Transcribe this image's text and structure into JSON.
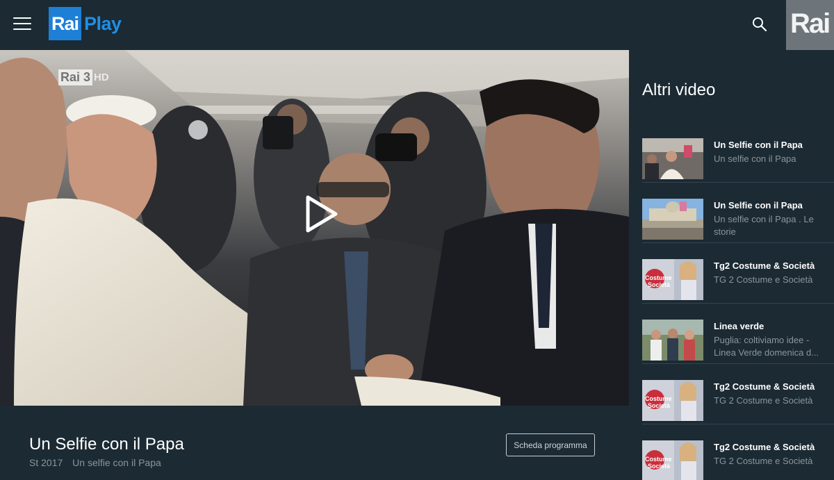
{
  "header": {
    "logo_rai": "Rai",
    "logo_play": "Play",
    "corner_brand": "Rai"
  },
  "player": {
    "channel_logo": "Rai 3",
    "channel_hd": "HD"
  },
  "program": {
    "title": "Un Selfie con il Papa",
    "season": "St 2017",
    "subtitle": "Un selfie con il Papa",
    "scheda_label": "Scheda programma"
  },
  "sidebar": {
    "title": "Altri video",
    "items": [
      {
        "title": "Un Selfie con il Papa",
        "subtitle": "Un selfie con il Papa"
      },
      {
        "title": "Un Selfie con il Papa",
        "subtitle": "Un selfie con il Papa . Le storie"
      },
      {
        "title": "Tg2 Costume & Società",
        "subtitle": "TG 2 Costume e Società"
      },
      {
        "title": "Linea verde",
        "subtitle": "Puglia: coltiviamo idee - Linea Verde domenica d..."
      },
      {
        "title": "Tg2 Costume & Società",
        "subtitle": "TG 2 Costume e Società"
      },
      {
        "title": "Tg2 Costume & Società",
        "subtitle": "TG 2 Costume e Società"
      }
    ]
  },
  "colors": {
    "background": "#1c2a33",
    "brand_blue": "#1e7fd6",
    "muted_text": "#8b969c"
  },
  "icons": [
    "menu-icon",
    "search-icon",
    "play-icon"
  ]
}
